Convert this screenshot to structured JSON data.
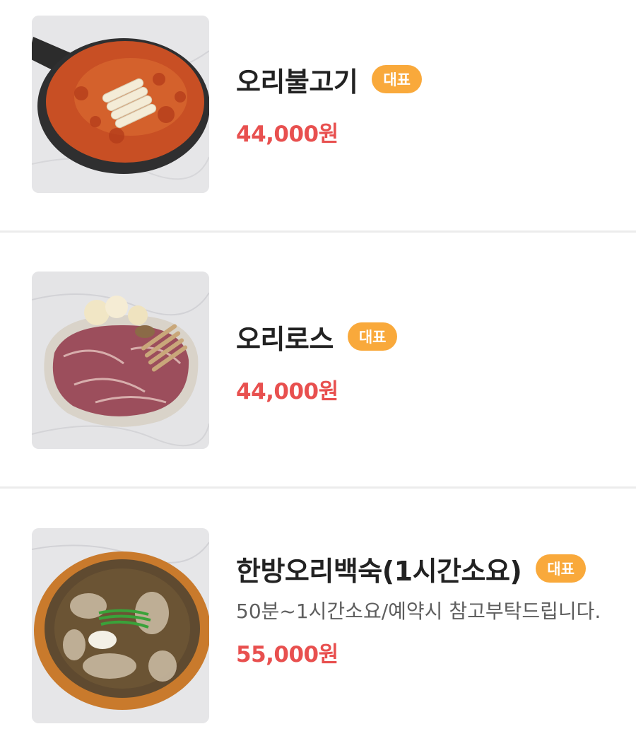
{
  "menu": {
    "items": [
      {
        "name": "오리불고기",
        "badge": "대표",
        "price": "44,000원",
        "image_icon": "duck-bulgogi-photo"
      },
      {
        "name": "오리로스",
        "badge": "대표",
        "price": "44,000원",
        "image_icon": "duck-roast-photo"
      },
      {
        "name": "한방오리백숙(1시간소요)",
        "badge": "대표",
        "description": "50분~1시간소요/예약시 참고부탁드립니다.",
        "price": "55,000원",
        "image_icon": "herbal-duck-soup-photo"
      }
    ]
  },
  "colors": {
    "badge": "#f9a93b",
    "price": "#e8504f",
    "divider": "#ececec"
  }
}
